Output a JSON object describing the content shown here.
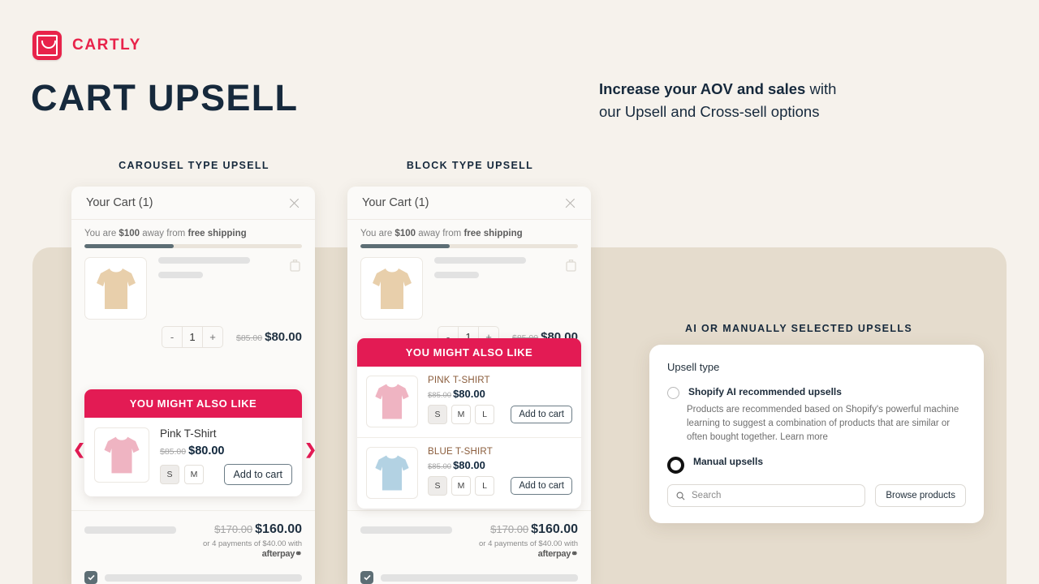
{
  "brand": {
    "name": "CARTLY",
    "logo_color": "#e8234a"
  },
  "header": {
    "title": "CART UPSELL",
    "tagline_bold": "Increase your AOV and sales",
    "tagline_rest": " with",
    "tagline_line2": "our Upsell and Cross-sell options"
  },
  "captions": {
    "carousel": "CAROUSEL TYPE UPSELL",
    "block": "BLOCK TYPE UPSELL",
    "settings": "AI OR MANUALLY SELECTED UPSELLS"
  },
  "cart": {
    "title": "Your Cart (1)",
    "shipping_prefix": "You are ",
    "shipping_amount": "$100",
    "shipping_mid": " away from ",
    "shipping_bold": "free shipping",
    "progress_percent": 41,
    "qty_minus": "-",
    "qty_value": "1",
    "qty_plus": "+",
    "item_price_old": "$85.00",
    "item_price_new": "$80.00",
    "total_old": "$170.00",
    "total_new": "$160.00",
    "afterpay_text": "or 4 payments of $40.00 with",
    "afterpay_logo": "afterpay",
    "close_icon": "close-icon",
    "trash_icon": "trash-icon"
  },
  "upsell_banner": "YOU MIGHT ALSO LIKE",
  "carousel_upsell": {
    "product_name": "Pink T-Shirt",
    "price_old": "$85.00",
    "price_new": "$80.00",
    "sizes": [
      "S",
      "M"
    ],
    "selected_size": "S",
    "add_to_cart": "Add to cart",
    "prev_icon": "chevron-left-icon",
    "next_icon": "chevron-right-icon"
  },
  "block_upsell": {
    "items": [
      {
        "name": "PINK T-SHIRT",
        "price_old": "$85.00",
        "price_new": "$80.00",
        "sizes": [
          "S",
          "M",
          "L"
        ],
        "selected_size": "S",
        "add_to_cart": "Add to cart",
        "shirt_color": "#efb4c2"
      },
      {
        "name": "BLUE T-SHIRT",
        "price_old": "$85.00",
        "price_new": "$80.00",
        "sizes": [
          "S",
          "M",
          "L"
        ],
        "selected_size": "S",
        "add_to_cart": "Add to cart",
        "shirt_color": "#b3d2e3"
      }
    ]
  },
  "settings": {
    "title": "Upsell type",
    "option_ai_label": "Shopify AI recommended upsells",
    "option_ai_desc": "Products are recommended based on Shopify's powerful machine learning to suggest a combination of products that are similar or often bought together. Learn more",
    "option_manual_label": "Manual upsells",
    "selected_option": "Manual upsells",
    "search_placeholder": "Search",
    "search_value": "",
    "browse_button": "Browse products",
    "search_icon": "search-icon"
  },
  "colors": {
    "accent": "#e31b54",
    "ink": "#16293c",
    "panel": "#e5dccd",
    "bg": "#f6f2ec"
  }
}
